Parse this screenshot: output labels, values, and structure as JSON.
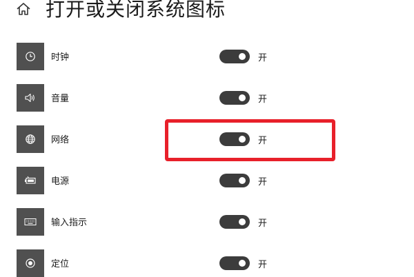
{
  "header": {
    "title": "打开或关闭系统图标",
    "home_icon": "home-icon"
  },
  "settings": [
    {
      "id": "clock",
      "label": "时钟",
      "icon": "clock-icon",
      "state": "开",
      "on": true
    },
    {
      "id": "volume",
      "label": "音量",
      "icon": "volume-icon",
      "state": "开",
      "on": true
    },
    {
      "id": "network",
      "label": "网络",
      "icon": "globe-icon",
      "state": "开",
      "on": true,
      "highlighted": true
    },
    {
      "id": "power",
      "label": "电源",
      "icon": "battery-icon",
      "state": "开",
      "on": true
    },
    {
      "id": "input",
      "label": "输入指示",
      "icon": "keyboard-icon",
      "state": "开",
      "on": true
    },
    {
      "id": "location",
      "label": "定位",
      "icon": "location-icon",
      "state": "开",
      "on": true
    }
  ],
  "colors": {
    "tile_bg": "#505050",
    "toggle_on": "#3c3c3c",
    "highlight": "#e8202a"
  }
}
